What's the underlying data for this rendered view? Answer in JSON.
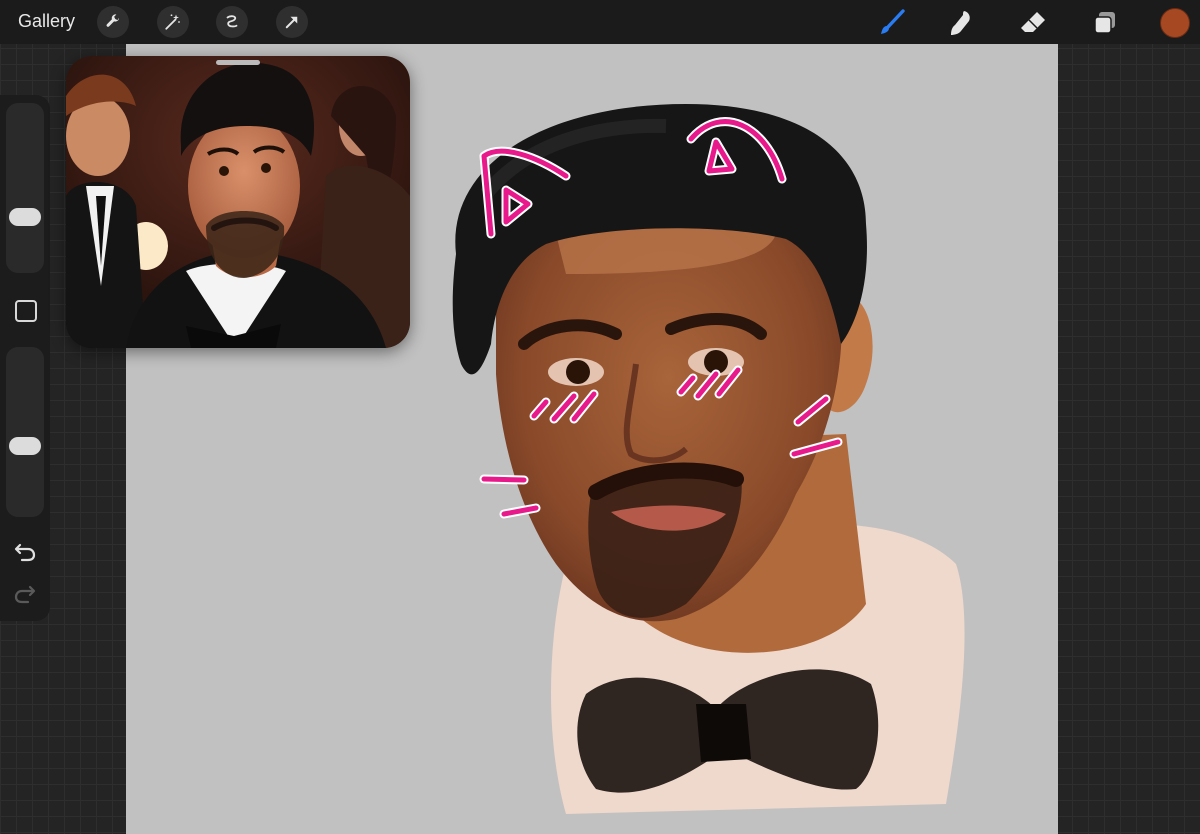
{
  "toolbar": {
    "gallery_label": "Gallery",
    "left_tools": [
      "wrench-icon",
      "magic-wand-icon",
      "selection-icon",
      "transform-arrow-icon"
    ],
    "right_tools": [
      "brush-icon",
      "smudge-icon",
      "eraser-icon",
      "layers-icon"
    ],
    "active_tool": "brush-icon",
    "accent_color": "#2a7cf2",
    "current_color": "#a64822"
  },
  "sidebar": {
    "brush_size_level": 0.3,
    "opacity_level": 0.4,
    "buttons": [
      "modify-button",
      "undo-button",
      "redo-button"
    ]
  },
  "canvas": {
    "background_color": "#c1c1c1",
    "annotation_color": "#e8198b"
  },
  "reference": {
    "visible": true
  }
}
